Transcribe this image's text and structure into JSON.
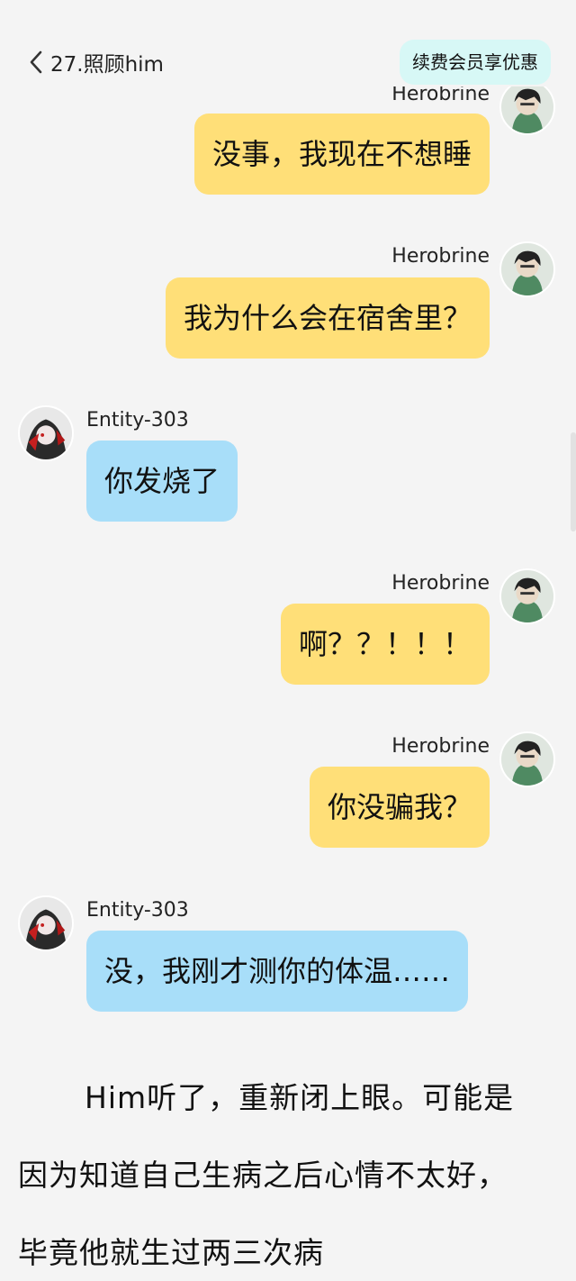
{
  "header": {
    "chapter_title": "27.照顾him",
    "vip_label": "续费会员享优惠"
  },
  "messages": [
    {
      "side": "right",
      "name": "Herobrine",
      "text": "没事，我现在不想睡"
    },
    {
      "side": "right",
      "name": "Herobrine",
      "text": "我为什么会在宿舍里？"
    },
    {
      "side": "left",
      "name": "Entity-303",
      "text": "你发烧了"
    },
    {
      "side": "right",
      "name": "Herobrine",
      "text": "啊？？！！！"
    },
    {
      "side": "right",
      "name": "Herobrine",
      "text": "你没骗我？"
    },
    {
      "side": "left",
      "name": "Entity-303",
      "text": "没，我刚才测你的体温……"
    }
  ],
  "narration": {
    "line1": "Him听了，重新闭上眼。可能是",
    "line2": "因为知道自己生病之后心情不太好，",
    "line3": "毕竟他就生过两三次病"
  },
  "colors": {
    "me_bubble": "#ffdf78",
    "other_bubble": "#a8def9",
    "vip_button": "#d7f8f6",
    "background": "#f4f4f4"
  },
  "icons": {
    "back": "chevron-left-icon",
    "herobrine_avatar": "herobrine-avatar",
    "entity_avatar": "entity-303-avatar"
  }
}
